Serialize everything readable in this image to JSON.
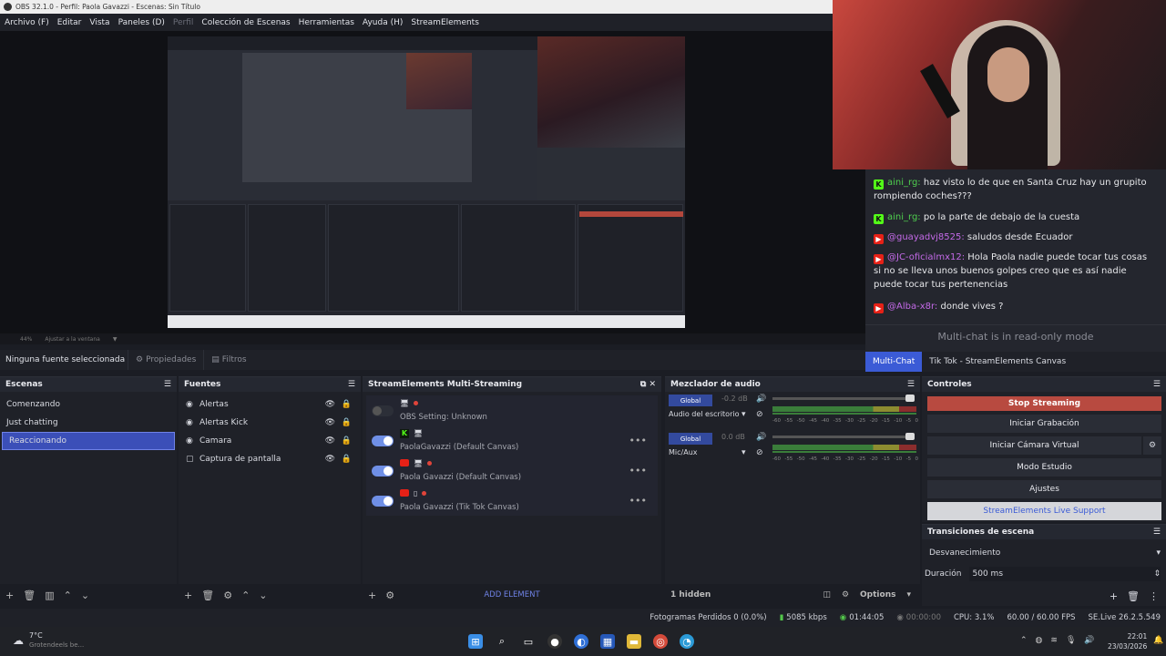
{
  "window": {
    "title": "OBS 32.1.0 - Perfil: Paola Gavazzi - Escenas: Sin Título"
  },
  "menu": [
    "Archivo (F)",
    "Editar",
    "Vista",
    "Paneles (D)",
    "Perfil",
    "Colección de Escenas",
    "Herramientas",
    "Ayuda (H)",
    "StreamElements"
  ],
  "preview": {
    "zoom": "44%",
    "fit": "Ajustar a la ventana"
  },
  "chat": {
    "messages": [
      {
        "platform": "kick",
        "user": "aini_rg:",
        "text": "haz visto lo de que en Santa Cruz hay un grupito rompiendo coches???"
      },
      {
        "platform": "kick",
        "user": "aini_rg:",
        "text": "po la parte de debajo de la cuesta"
      },
      {
        "platform": "youtube",
        "user": "@guayadvj8525:",
        "text": "saludos desde Ecuador"
      },
      {
        "platform": "youtube",
        "user": "@JC-oficialmx12:",
        "text": "Hola Paola nadie puede tocar tus cosas si no se lleva unos buenos golpes creo que es así nadie puede tocar tus pertenencias"
      },
      {
        "platform": "youtube",
        "user": "@Alba-x8r:",
        "text": "donde vives ?"
      }
    ],
    "readonly": "Multi-chat is in read-only mode",
    "tabs": [
      "Multi-Chat",
      "Tik Tok - StreamElements Canvas"
    ]
  },
  "source_bar": {
    "none": "Ninguna fuente seleccionada",
    "properties": "Propiedades",
    "filters": "Filtros"
  },
  "scenes": {
    "title": "Escenas",
    "items": [
      "Comenzando",
      "Just chatting",
      "Reaccionando"
    ],
    "selected": 2
  },
  "sources": {
    "title": "Fuentes",
    "items": [
      "Alertas",
      "Alertas Kick",
      "Camara",
      "Captura de pantalla"
    ]
  },
  "multistream": {
    "title": "StreamElements Multi-Streaming",
    "rows": [
      "OBS Setting: Unknown",
      "PaolaGavazzi (Default Canvas)",
      "Paola Gavazzi (Default Canvas)",
      "Paola Gavazzi (Tik Tok Canvas)"
    ],
    "add": "ADD ELEMENT"
  },
  "mixer": {
    "title": "Mezclador de audio",
    "channels": [
      {
        "global": "Global",
        "db": "-0.2 dB",
        "name": "Audio del escritorio"
      },
      {
        "global": "Global",
        "db": "0.0 dB",
        "name": "Mic/Aux"
      }
    ],
    "scale": [
      "-60",
      "-55",
      "-50",
      "-45",
      "-40",
      "-35",
      "-30",
      "-25",
      "-20",
      "-15",
      "-10",
      "-5",
      "0"
    ],
    "hidden": "1 hidden",
    "options": "Options"
  },
  "controls": {
    "title": "Controles",
    "buttons": [
      "Stop Streaming",
      "Iniciar Grabación",
      "Iniciar Cámara Virtual",
      "Modo Estudio",
      "Ajustes",
      "StreamElements Live Support"
    ]
  },
  "transitions": {
    "title": "Transiciones de escena",
    "type": "Desvanecimiento",
    "duration_label": "Duración",
    "duration": "500 ms"
  },
  "status": {
    "dropped": "Fotogramas Perdidos 0 (0.0%)",
    "bitrate": "5085 kbps",
    "live": "01:44:05",
    "rec": "00:00:00",
    "cpu": "CPU: 3.1%",
    "fps": "60.00 / 60.00 FPS",
    "se": "SE.Live 26.2.5.549"
  },
  "taskbar": {
    "weather": "7°C",
    "weather_sub": "Grotendeels be...",
    "time": "22:01",
    "date": "23/03/2026"
  },
  "colors": {
    "accent": "#3b5bd6",
    "stop": "#b84a40",
    "kick": "#53fc18",
    "youtube": "#e62117"
  }
}
